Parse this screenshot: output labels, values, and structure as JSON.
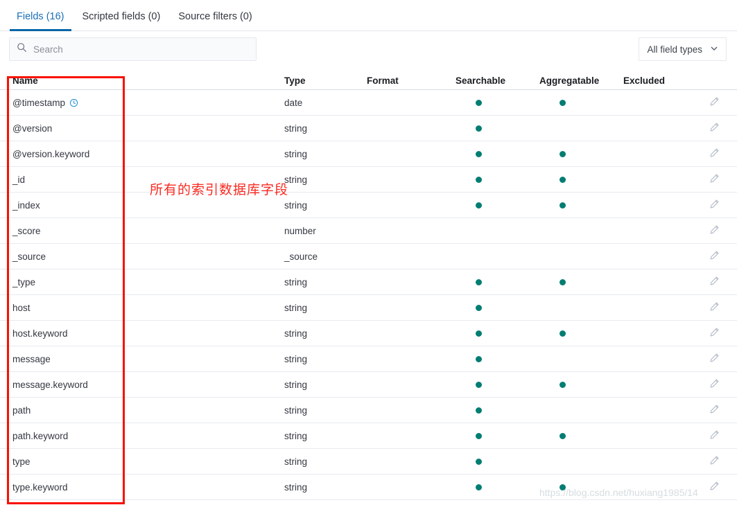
{
  "tabs": [
    {
      "label": "Fields (16)",
      "name": "tab-fields",
      "active": true
    },
    {
      "label": "Scripted fields (0)",
      "name": "tab-scripted-fields",
      "active": false
    },
    {
      "label": "Source filters (0)",
      "name": "tab-source-filters",
      "active": false
    }
  ],
  "search": {
    "placeholder": "Search",
    "value": "",
    "icon": "search-icon"
  },
  "field_types_filter": {
    "label": "All field types",
    "icon": "chevron-down-icon"
  },
  "table": {
    "columns": [
      "Name",
      "Type",
      "Format",
      "Searchable",
      "Aggregatable",
      "Excluded"
    ],
    "edit_icon": "pencil-icon",
    "time_field_icon": "clock-icon",
    "rows": [
      {
        "name": "@timestamp",
        "type": "date",
        "format": "",
        "searchable": true,
        "aggregatable": true,
        "excluded": "",
        "time_field": true
      },
      {
        "name": "@version",
        "type": "string",
        "format": "",
        "searchable": true,
        "aggregatable": false,
        "excluded": "",
        "time_field": false
      },
      {
        "name": "@version.keyword",
        "type": "string",
        "format": "",
        "searchable": true,
        "aggregatable": true,
        "excluded": "",
        "time_field": false
      },
      {
        "name": "_id",
        "type": "string",
        "format": "",
        "searchable": true,
        "aggregatable": true,
        "excluded": "",
        "time_field": false
      },
      {
        "name": "_index",
        "type": "string",
        "format": "",
        "searchable": true,
        "aggregatable": true,
        "excluded": "",
        "time_field": false
      },
      {
        "name": "_score",
        "type": "number",
        "format": "",
        "searchable": false,
        "aggregatable": false,
        "excluded": "",
        "time_field": false
      },
      {
        "name": "_source",
        "type": "_source",
        "format": "",
        "searchable": false,
        "aggregatable": false,
        "excluded": "",
        "time_field": false
      },
      {
        "name": "_type",
        "type": "string",
        "format": "",
        "searchable": true,
        "aggregatable": true,
        "excluded": "",
        "time_field": false
      },
      {
        "name": "host",
        "type": "string",
        "format": "",
        "searchable": true,
        "aggregatable": false,
        "excluded": "",
        "time_field": false
      },
      {
        "name": "host.keyword",
        "type": "string",
        "format": "",
        "searchable": true,
        "aggregatable": true,
        "excluded": "",
        "time_field": false
      },
      {
        "name": "message",
        "type": "string",
        "format": "",
        "searchable": true,
        "aggregatable": false,
        "excluded": "",
        "time_field": false
      },
      {
        "name": "message.keyword",
        "type": "string",
        "format": "",
        "searchable": true,
        "aggregatable": true,
        "excluded": "",
        "time_field": false
      },
      {
        "name": "path",
        "type": "string",
        "format": "",
        "searchable": true,
        "aggregatable": false,
        "excluded": "",
        "time_field": false
      },
      {
        "name": "path.keyword",
        "type": "string",
        "format": "",
        "searchable": true,
        "aggregatable": true,
        "excluded": "",
        "time_field": false
      },
      {
        "name": "type",
        "type": "string",
        "format": "",
        "searchable": true,
        "aggregatable": false,
        "excluded": "",
        "time_field": false
      },
      {
        "name": "type.keyword",
        "type": "string",
        "format": "",
        "searchable": true,
        "aggregatable": true,
        "excluded": "",
        "time_field": false
      }
    ]
  },
  "annotations": {
    "red_note": "所有的索引数据库字段",
    "watermark": "https://blog.csdn.net/huxiang1985/14"
  },
  "colors": {
    "accent_blue": "#0366a8",
    "dot_teal": "#017d73",
    "annotation_red": "#fa0f00"
  }
}
